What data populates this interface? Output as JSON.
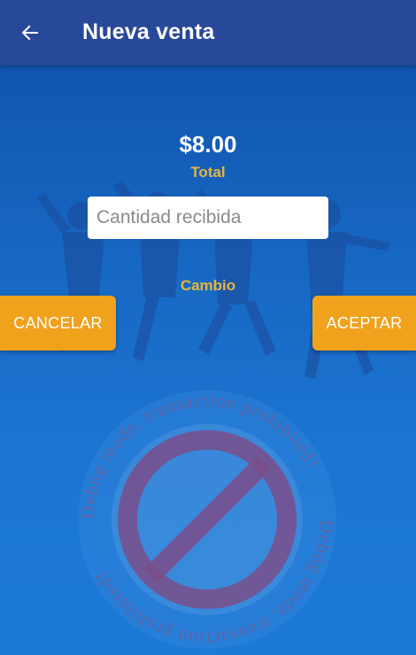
{
  "header": {
    "title": "Nueva venta",
    "back_icon": "arrow-left-icon"
  },
  "sale": {
    "total_amount": "$8.00",
    "total_label": "Total",
    "received_placeholder": "Cantidad recibida",
    "received_value": "",
    "change_label": "Cambio"
  },
  "actions": {
    "cancel_label": "CANCELAR",
    "accept_label": "ACEPTAR"
  },
  "watermark": {
    "text": "Debug mode, transaction prohibited!",
    "icon": "prohibited-icon"
  },
  "colors": {
    "appbar": "#28489a",
    "background": "#1b76d2",
    "accent": "#f0a21c",
    "label": "#e8b43c"
  }
}
